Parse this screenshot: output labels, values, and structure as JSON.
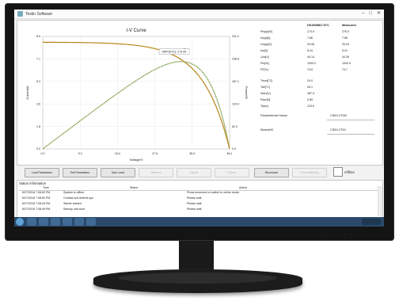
{
  "window": {
    "title": "Testin Software"
  },
  "chart": {
    "title": "I-V Curve",
    "xlabel": "Voltage/V",
    "ylabel_left": "Current/A",
    "ylabel_right": "Power/W",
    "mpp_label": "MPP(STC): 274.99"
  },
  "chart_data": {
    "type": "line",
    "title": "I-V Curve",
    "xlabel": "Voltage/V",
    "ylabel": "Current/A",
    "y2label": "Power/W",
    "xlim": [
      0,
      46.1
    ],
    "ylim": [
      0,
      8.9
    ],
    "y2lim": [
      0,
      311.0
    ],
    "x_ticks": [
      "0.0",
      "9.2",
      "18.4",
      "27.6",
      "36.9",
      "46.1"
    ],
    "y_ticks": [
      "0.0",
      "1.8",
      "3.6",
      "5.3",
      "7.1",
      "8.9"
    ],
    "y2_ticks": [
      "0.0",
      "62.2",
      "124.4",
      "187.1",
      "248.8",
      "311.0"
    ],
    "mpp": {
      "v": 34.98,
      "i": 7.86,
      "p": 274.9
    },
    "grid": true,
    "series": [
      {
        "name": "I-V",
        "color": "#b8861b",
        "curve": {
          "isc": 8.44,
          "voc": 46.1,
          "vmp": 34.98,
          "imp": 7.86
        }
      },
      {
        "name": "P-V",
        "color": "#6a8f2a",
        "curve": {
          "isc": 8.44,
          "voc": 46.1,
          "vmp": 34.98,
          "imp": 7.86
        }
      }
    ]
  },
  "params": {
    "col1": "DK360M61 STC",
    "col2": "Measured",
    "rows": [
      {
        "label": "Pmpp[W]",
        "v1": "274.9",
        "v2": "276.0"
      },
      {
        "label": "Impp[A]",
        "v1": "7.86",
        "v2": "7.86"
      },
      {
        "label": "Umpp[V]",
        "v1": "34.98",
        "v2": "35.04"
      },
      {
        "label": "Isc[A]",
        "v1": "8.44",
        "v2": "8.41"
      },
      {
        "label": "Uoc[V]",
        "v1": "44.14",
        "v2": "44.26"
      },
      {
        "label": "Pin[W]",
        "v1": "1000.0",
        "v2": "1000.5"
      },
      {
        "label": "FF[%]",
        "v1": "73.6",
        "v2": "73.7"
      },
      {
        "label": "Tmod[°C]",
        "v1": "24.0",
        "v2": ""
      },
      {
        "label": "Tair[°C]",
        "v1": "25.1",
        "v2": ""
      },
      {
        "label": "Sdev[V]",
        "v1": "387.5",
        "v2": ""
      },
      {
        "label": "Rser[Ω]",
        "v1": "0.89",
        "v2": ""
      },
      {
        "label": "T[sec]",
        "v1": "123.6",
        "v2": ""
      }
    ],
    "param_name_label": "Parameterset Name",
    "param_name_value": "CS6X-270M",
    "module_label": "ModuleID",
    "module_value": "CS6X-275X"
  },
  "buttons": [
    {
      "label": "Load Parameters",
      "enabled": true
    },
    {
      "label": "Edit Parameters",
      "enabled": true
    },
    {
      "label": "User Level",
      "enabled": true
    },
    {
      "label": "Measure",
      "enabled": false
    },
    {
      "label": "Cancel",
      "enabled": false
    },
    {
      "label": "Export",
      "enabled": false
    },
    {
      "label": "Reconnect",
      "enabled": true
    },
    {
      "label": "Preconditioning",
      "enabled": false
    }
  ],
  "offline_label": "Offline",
  "status": {
    "caption": "Status Information",
    "headers": [
      "Time",
      "Status",
      "Action"
    ],
    "rows": [
      {
        "time": "6/27/2018 7:08:52 PM",
        "status": "System is offline.",
        "action": "Press reconnect or switch to online mode."
      },
      {
        "time": "6/27/2018 7:08:52 PM",
        "status": "Contact unit Ambrel.sys",
        "action": "Please wait."
      },
      {
        "time": "6/27/2018 7:08:49 PM",
        "status": "Starter started",
        "action": "Please wait."
      },
      {
        "time": "6/27/2018 7:08:49 PM",
        "status": "Startup unit done",
        "action": "Please wait."
      }
    ]
  }
}
